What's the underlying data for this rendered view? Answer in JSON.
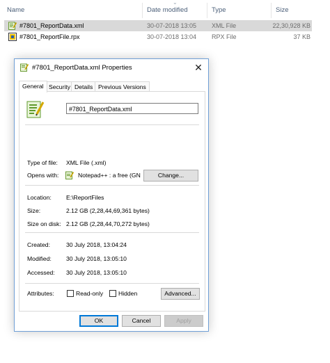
{
  "list": {
    "headers": {
      "name": "Name",
      "date": "Date modified",
      "type": "Type",
      "size": "Size"
    },
    "rows": [
      {
        "name": "#7801_ReportData.xml",
        "date": "30-07-2018 13:05",
        "type": "XML File",
        "size": "22,30,928 KB",
        "icon": "notepadpp-xml-icon"
      },
      {
        "name": "#7801_ReportFile.rpx",
        "date": "30-07-2018 13:04",
        "type": "RPX File",
        "size": "37 KB",
        "icon": "rpx-file-icon"
      }
    ]
  },
  "dialog": {
    "title": "#7801_ReportData.xml Properties",
    "close_glyph": "✕",
    "tabs": [
      "General",
      "Security",
      "Details",
      "Previous Versions"
    ],
    "active_tab": "General",
    "file_name": "#7801_ReportData.xml",
    "type_label": "Type of file:",
    "type_value": "XML File (.xml)",
    "opens_label": "Opens with:",
    "opens_value": "Notepad++ : a free (GN",
    "change_button": "Change...",
    "location_label": "Location:",
    "location_value": "E:\\ReportFiles",
    "size_label": "Size:",
    "size_value": "2.12 GB (2,28,44,69,361 bytes)",
    "size_disk_label": "Size on disk:",
    "size_disk_value": "2.12 GB (2,28,44,70,272 bytes)",
    "created_label": "Created:",
    "created_value": "30 July 2018, 13:04:24",
    "modified_label": "Modified:",
    "modified_value": "30 July 2018, 13:05:10",
    "accessed_label": "Accessed:",
    "accessed_value": "30 July 2018, 13:05:10",
    "attributes_label": "Attributes:",
    "readonly_label": "Read-only",
    "readonly_checked": false,
    "hidden_label": "Hidden",
    "hidden_checked": false,
    "advanced_button": "Advanced...",
    "ok_button": "OK",
    "cancel_button": "Cancel",
    "apply_button": "Apply",
    "apply_enabled": false
  },
  "colors": {
    "selection": "#d9d9d9",
    "header_text": "#4c607a",
    "accent": "#0078d7"
  }
}
